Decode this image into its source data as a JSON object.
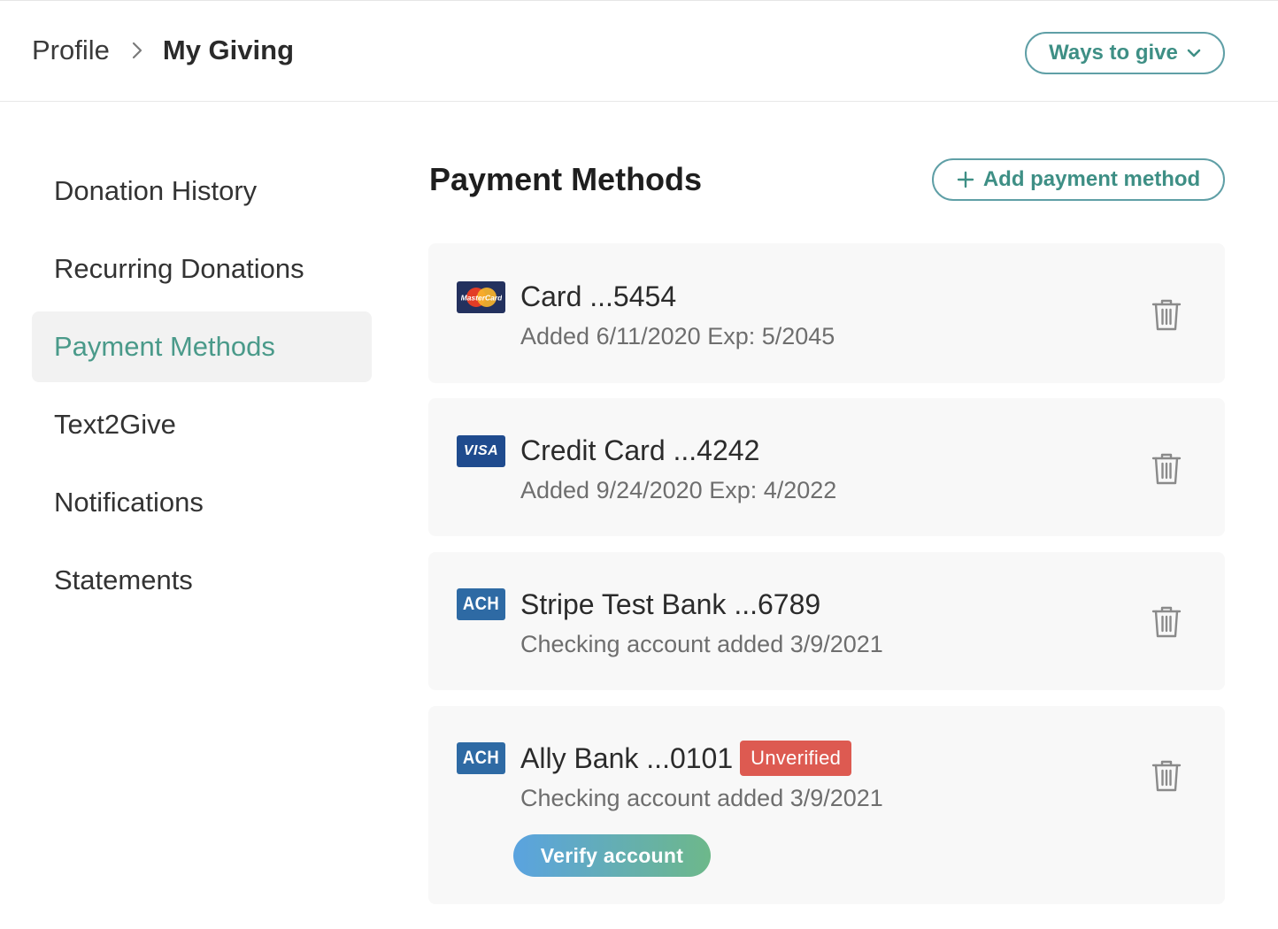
{
  "header": {
    "breadcrumb": {
      "parent": "Profile",
      "current": "My Giving"
    },
    "ways_to_give_label": "Ways to give",
    "accent_color": "#3e8f85"
  },
  "sidebar": {
    "items": [
      {
        "label": "Donation History",
        "active": false
      },
      {
        "label": "Recurring Donations",
        "active": false
      },
      {
        "label": "Payment Methods",
        "active": true
      },
      {
        "label": "Text2Give",
        "active": false
      },
      {
        "label": "Notifications",
        "active": false
      },
      {
        "label": "Statements",
        "active": false
      }
    ]
  },
  "main": {
    "title": "Payment Methods",
    "add_button_label": "Add payment method",
    "payment_methods": [
      {
        "brand": "mastercard",
        "brand_label": "MasterCard",
        "title": "Card ...5454",
        "subtitle": "Added 6/11/2020 Exp: 5/2045"
      },
      {
        "brand": "visa",
        "brand_label": "VISA",
        "title": "Credit Card ...4242",
        "subtitle": "Added 9/24/2020 Exp: 4/2022"
      },
      {
        "brand": "ach",
        "brand_label": "ACH",
        "title": "Stripe Test Bank ...6789",
        "subtitle": "Checking account added 3/9/2021"
      },
      {
        "brand": "ach",
        "brand_label": "ACH",
        "title": "Ally Bank ...0101",
        "badge": "Unverified",
        "badge_color": "#dd5a51",
        "subtitle": "Checking account added 3/9/2021",
        "verify_label": "Verify account"
      }
    ]
  },
  "icons": {
    "chevron-right": "chevron-right-icon",
    "chevron-down": "chevron-down-icon",
    "plus": "plus-icon",
    "trash": "trash-icon"
  }
}
